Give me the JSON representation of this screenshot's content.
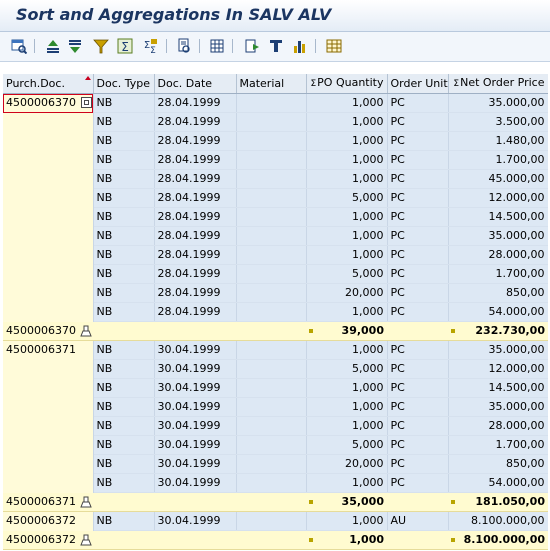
{
  "window": {
    "title": "Sort and Aggregations In SALV ALV"
  },
  "toolbar": {
    "buttons": [
      {
        "name": "details-icon"
      },
      {
        "name": "sort-ascending-icon"
      },
      {
        "name": "sort-descending-icon"
      },
      {
        "name": "set-filter-icon"
      },
      {
        "name": "total-icon"
      },
      {
        "name": "subtotal-icon"
      },
      {
        "name": "print-preview-icon"
      },
      {
        "name": "spreadsheet-export-icon"
      },
      {
        "name": "word-processing-icon"
      },
      {
        "name": "local-file-icon"
      },
      {
        "name": "graphic-icon"
      },
      {
        "name": "change-layout-icon"
      }
    ]
  },
  "grid": {
    "columns": [
      {
        "label": "Purch.Doc.",
        "sorted": "asc"
      },
      {
        "label": "Doc. Type"
      },
      {
        "label": "Doc. Date"
      },
      {
        "label": "Material"
      },
      {
        "label": "PO Quantity",
        "aggregated": true,
        "sigma": "Σ"
      },
      {
        "label": "Order Unit"
      },
      {
        "label": "Net Order Price",
        "aggregated": true,
        "sigma": "Σ"
      }
    ],
    "groups": [
      {
        "doc": "4500006370",
        "rows": [
          {
            "type": "NB",
            "date": "28.04.1999",
            "material": "",
            "qty": "1,000",
            "unit": "PC",
            "price": "35.000,00"
          },
          {
            "type": "NB",
            "date": "28.04.1999",
            "material": "",
            "qty": "1,000",
            "unit": "PC",
            "price": "3.500,00"
          },
          {
            "type": "NB",
            "date": "28.04.1999",
            "material": "",
            "qty": "1,000",
            "unit": "PC",
            "price": "1.480,00"
          },
          {
            "type": "NB",
            "date": "28.04.1999",
            "material": "",
            "qty": "1,000",
            "unit": "PC",
            "price": "1.700,00"
          },
          {
            "type": "NB",
            "date": "28.04.1999",
            "material": "",
            "qty": "1,000",
            "unit": "PC",
            "price": "45.000,00"
          },
          {
            "type": "NB",
            "date": "28.04.1999",
            "material": "",
            "qty": "5,000",
            "unit": "PC",
            "price": "12.000,00"
          },
          {
            "type": "NB",
            "date": "28.04.1999",
            "material": "",
            "qty": "1,000",
            "unit": "PC",
            "price": "14.500,00"
          },
          {
            "type": "NB",
            "date": "28.04.1999",
            "material": "",
            "qty": "1,000",
            "unit": "PC",
            "price": "35.000,00"
          },
          {
            "type": "NB",
            "date": "28.04.1999",
            "material": "",
            "qty": "1,000",
            "unit": "PC",
            "price": "28.000,00"
          },
          {
            "type": "NB",
            "date": "28.04.1999",
            "material": "",
            "qty": "5,000",
            "unit": "PC",
            "price": "1.700,00"
          },
          {
            "type": "NB",
            "date": "28.04.1999",
            "material": "",
            "qty": "20,000",
            "unit": "PC",
            "price": "850,00"
          },
          {
            "type": "NB",
            "date": "28.04.1999",
            "material": "",
            "qty": "1,000",
            "unit": "PC",
            "price": "54.000,00"
          }
        ],
        "subtotal": {
          "doc": "4500006370",
          "qty": "39,000",
          "price": "232.730,00"
        }
      },
      {
        "doc": "4500006371",
        "rows": [
          {
            "type": "NB",
            "date": "30.04.1999",
            "material": "",
            "qty": "1,000",
            "unit": "PC",
            "price": "35.000,00"
          },
          {
            "type": "NB",
            "date": "30.04.1999",
            "material": "",
            "qty": "5,000",
            "unit": "PC",
            "price": "12.000,00"
          },
          {
            "type": "NB",
            "date": "30.04.1999",
            "material": "",
            "qty": "1,000",
            "unit": "PC",
            "price": "14.500,00"
          },
          {
            "type": "NB",
            "date": "30.04.1999",
            "material": "",
            "qty": "1,000",
            "unit": "PC",
            "price": "35.000,00"
          },
          {
            "type": "NB",
            "date": "30.04.1999",
            "material": "",
            "qty": "1,000",
            "unit": "PC",
            "price": "28.000,00"
          },
          {
            "type": "NB",
            "date": "30.04.1999",
            "material": "",
            "qty": "5,000",
            "unit": "PC",
            "price": "1.700,00"
          },
          {
            "type": "NB",
            "date": "30.04.1999",
            "material": "",
            "qty": "20,000",
            "unit": "PC",
            "price": "850,00"
          },
          {
            "type": "NB",
            "date": "30.04.1999",
            "material": "",
            "qty": "1,000",
            "unit": "PC",
            "price": "54.000,00"
          }
        ],
        "subtotal": {
          "doc": "4500006371",
          "qty": "35,000",
          "price": "181.050,00"
        }
      },
      {
        "doc": "4500006372",
        "rows": [
          {
            "type": "NB",
            "date": "30.04.1999",
            "material": "",
            "qty": "1,000",
            "unit": "AU",
            "price": "8.100.000,00"
          }
        ],
        "subtotal": {
          "doc": "4500006372",
          "qty": "1,000",
          "price": "8.100.000,00"
        }
      }
    ]
  },
  "colors": {
    "title": "#1b3561",
    "row_bg": "#dde8f4",
    "key_bg": "#fffbd9",
    "subtotal_bg": "#fffbd0",
    "header_bg": "#e5ecf4",
    "selection_border": "#d0021b"
  }
}
